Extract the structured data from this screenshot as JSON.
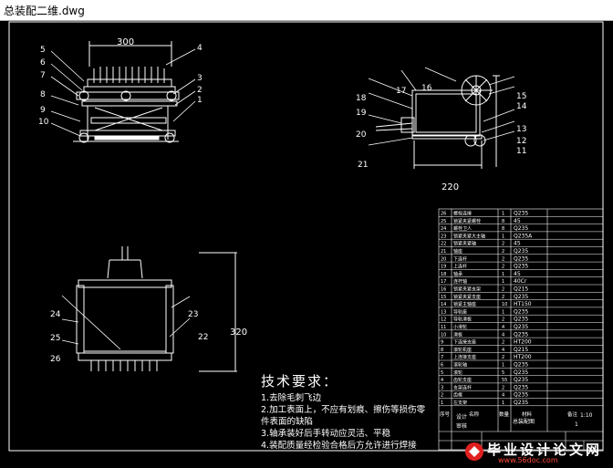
{
  "window": {
    "title": "总装配二维.dwg"
  },
  "views": {
    "front": {
      "dimension_top": "300",
      "labels_left": [
        "5",
        "6",
        "7",
        "8",
        "9",
        "10"
      ],
      "labels_right": [
        "4",
        "3",
        "2",
        "1"
      ]
    },
    "side": {
      "dimension_bottom": "220",
      "labels_left": [
        "18",
        "19",
        "20",
        "21"
      ],
      "labels_top": [
        "17",
        "16"
      ],
      "labels_right": [
        "15",
        "14",
        "13",
        "12",
        "11"
      ]
    },
    "bottom": {
      "dimension_right": "320",
      "labels_left": [
        "24",
        "25",
        "26"
      ],
      "labels_right": [
        "23",
        "22"
      ]
    }
  },
  "tech_requirements": {
    "heading": "技术要求：",
    "lines": [
      "1.去除毛刺飞边",
      "2.加工表面上，不应有划痕、擦伤等损伤零",
      "件表面的缺陷",
      "3.轴承装好后手转动应灵活、平稳",
      "4.装配质量经检验合格后方允许进行焊接"
    ]
  },
  "bom": {
    "rows": [
      {
        "no": "26",
        "name": "螺栓连接",
        "qty": "1",
        "mat": "Q235"
      },
      {
        "no": "25",
        "name": "锁紧夹紧螺栓",
        "qty": "8",
        "mat": "45"
      },
      {
        "no": "24",
        "name": "螺栓卫人",
        "qty": "8",
        "mat": "Q235"
      },
      {
        "no": "23",
        "name": "锁紧夹紧大主轴",
        "qty": "1",
        "mat": "Q235A"
      },
      {
        "no": "22",
        "name": "锁紧夹紧轴",
        "qty": "2",
        "mat": "45"
      },
      {
        "no": "21",
        "name": "轴座",
        "qty": "2",
        "mat": "Q235"
      },
      {
        "no": "20",
        "name": "下连杆",
        "qty": "2",
        "mat": "Q235"
      },
      {
        "no": "19",
        "name": "上连杆",
        "qty": "2",
        "mat": "Q235"
      },
      {
        "no": "18",
        "name": "轴承",
        "qty": "1",
        "mat": "45"
      },
      {
        "no": "17",
        "name": "连杆轴",
        "qty": "1",
        "mat": "40Cr"
      },
      {
        "no": "16",
        "name": "锁紧夹紧支架",
        "qty": "2",
        "mat": "Q215"
      },
      {
        "no": "15",
        "name": "锁紧夹紧支座",
        "qty": "2",
        "mat": "Q235"
      },
      {
        "no": "14",
        "name": "锁紧主轴座",
        "qty": "10",
        "mat": "HT150"
      },
      {
        "no": "13",
        "name": "导轨座",
        "qty": "1",
        "mat": "Q235"
      },
      {
        "no": "12",
        "name": "导轨滑板",
        "qty": "2",
        "mat": "Q235"
      },
      {
        "no": "11",
        "name": "小滑轮",
        "qty": "4",
        "mat": "Q235"
      },
      {
        "no": "10",
        "name": "滑板",
        "qty": "4",
        "mat": "Q235"
      },
      {
        "no": "9",
        "name": "下连接支座",
        "qty": "2",
        "mat": "HT200"
      },
      {
        "no": "8",
        "name": "滚轮机座",
        "qty": "4",
        "mat": "Q215"
      },
      {
        "no": "7",
        "name": "上连接支座",
        "qty": "2",
        "mat": "HT200"
      },
      {
        "no": "6",
        "name": "滚轮轴",
        "qty": "1",
        "mat": "Q235"
      },
      {
        "no": "5",
        "name": "滚轮",
        "qty": "5",
        "mat": "Q235"
      },
      {
        "no": "4",
        "name": "齿轮支座",
        "qty": "55",
        "mat": "Q235"
      },
      {
        "no": "3",
        "name": "支架连杆",
        "qty": "2",
        "mat": "Q235"
      },
      {
        "no": "2",
        "name": "齿框",
        "qty": "4",
        "mat": "Q235"
      },
      {
        "no": "1",
        "name": "左支架",
        "qty": "1",
        "mat": "Q235"
      }
    ],
    "header": {
      "no": "序号",
      "name": "名称",
      "qty": "数量",
      "mat": "材料",
      "note": "备注"
    },
    "title_block": {
      "design": "设计",
      "check": "审核",
      "drawing_title": "总装配图",
      "scale": "1:10",
      "sheet": "1"
    }
  },
  "watermark": {
    "brand": "毕业设计论文网",
    "url": "www.56doc.com"
  },
  "colors": {
    "line": "#ffffff",
    "label": "#ffffff",
    "dim": "#ffffff",
    "accent": "#ffff00",
    "bom_border": "#ffffff",
    "table_fill": "#ffffff"
  }
}
